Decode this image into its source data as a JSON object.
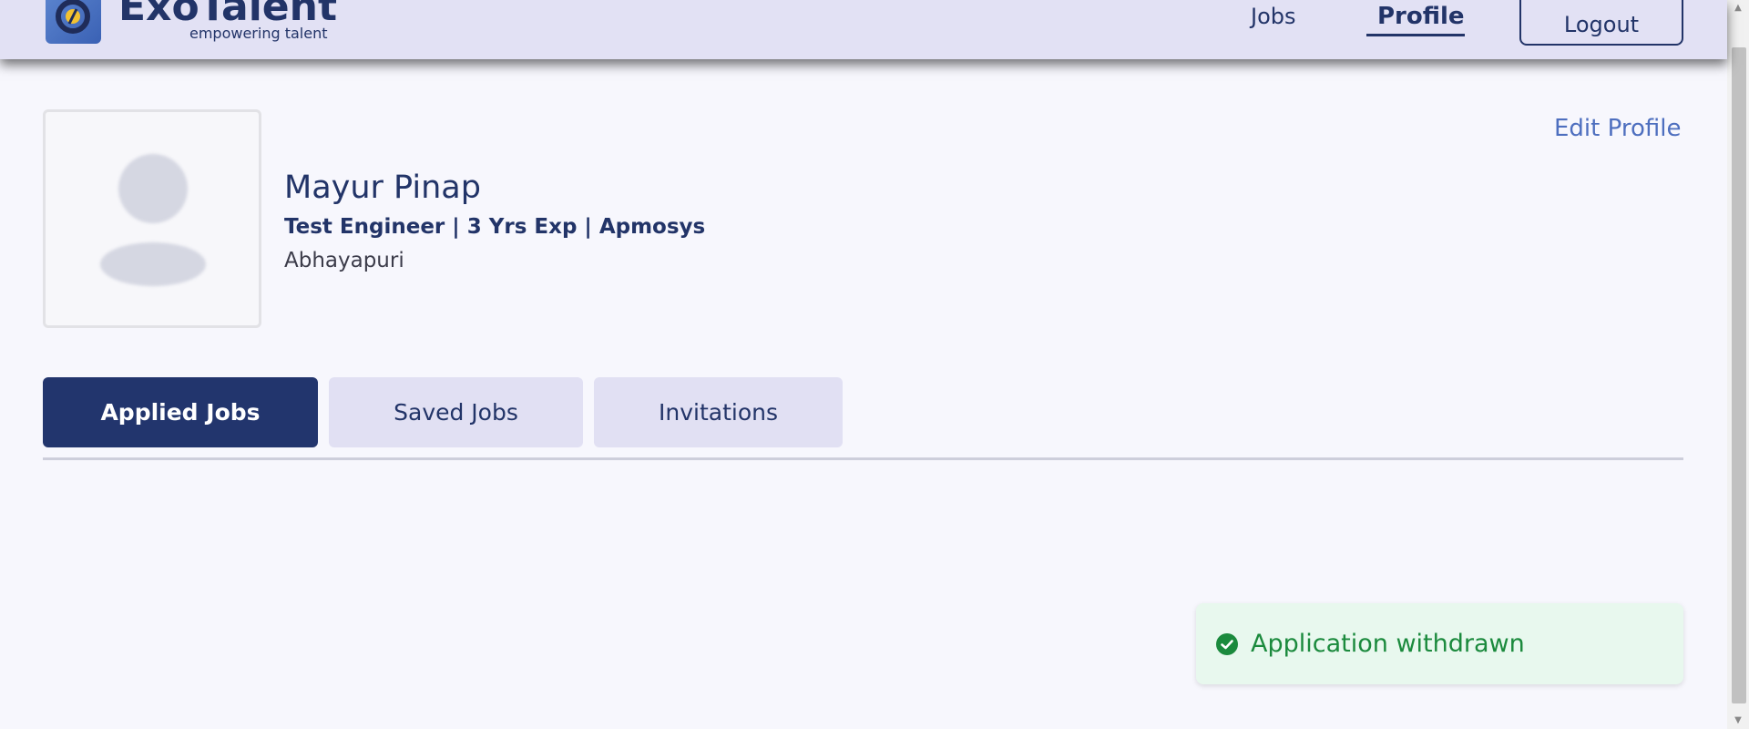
{
  "header": {
    "brand_name": "ExoTalent",
    "brand_tagline": "empowering talent",
    "nav": {
      "jobs_label": "Jobs",
      "profile_label": "Profile"
    },
    "logout_label": "Logout"
  },
  "profile": {
    "name": "Mayur Pinap",
    "headline": "Test Engineer | 3 Yrs Exp | Apmosys",
    "location": "Abhayapuri",
    "edit_label": "Edit Profile"
  },
  "tabs": [
    {
      "label": "Applied Jobs",
      "active": true
    },
    {
      "label": "Saved Jobs",
      "active": false
    },
    {
      "label": "Invitations",
      "active": false
    }
  ],
  "toast": {
    "message": "Application withdrawn",
    "status": "success"
  },
  "colors": {
    "primary": "#22356d",
    "header_bg": "#e2e1f4",
    "link": "#4e6fbf",
    "success": "#1b8a3d",
    "success_bg": "#e8f8ee"
  }
}
